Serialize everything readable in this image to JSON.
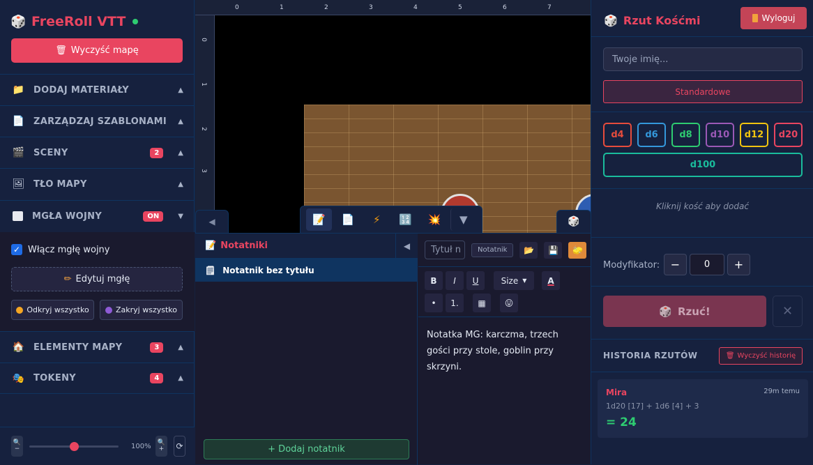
{
  "app": {
    "title": "FreeRoll VTT"
  },
  "left": {
    "clear_map": "Wyczyść mapę",
    "sections": [
      {
        "label": "DODAJ MATERIAŁY",
        "icon": "folder-icon"
      },
      {
        "label": "ZARZĄDZAJ SZABLONAMI",
        "icon": "document-icon"
      },
      {
        "label": "SCENY",
        "icon": "clapper-icon",
        "badge": "2"
      },
      {
        "label": "TŁO MAPY",
        "icon": "picture-icon"
      },
      {
        "label": "MGŁA WOJNY",
        "icon": "fog-icon",
        "badge": "ON"
      },
      {
        "label": "ELEMENTY MAPY",
        "icon": "house-icon",
        "badge": "3"
      },
      {
        "label": "TOKENY",
        "icon": "masks-icon",
        "badge": "4"
      }
    ],
    "fog": {
      "enable_label": "Włącz mgłę wojny",
      "edit_label": "Edytuj mgłę",
      "reveal_all": "Odkryj wszystko",
      "hide_all": "Zakryj wszystko"
    },
    "zoom": {
      "value": "100%",
      "level": 0.5
    }
  },
  "canvas": {
    "ruler_x": [
      "0",
      "1",
      "2",
      "3",
      "4",
      "5",
      "6",
      "7"
    ],
    "ruler_y": [
      "0",
      "1",
      "2",
      "3"
    ]
  },
  "notes": {
    "title": "Notatniki",
    "items": [
      "Notatnik bez tytułu"
    ],
    "add_label": "+ Dodaj notatnik",
    "title_placeholder": "Tytuł n",
    "type_tag": "Notatnik",
    "format": {
      "bold": "B",
      "italic": "I",
      "underline": "U",
      "size": "Size",
      "color": "A",
      "bullet": "•",
      "numbered": "1."
    },
    "content": "Notatka MG: karczma, trzech gości przy stole, goblin przy skrzyni."
  },
  "right": {
    "title": "Rzut Kośćmi",
    "logout": "Wyloguj",
    "name_placeholder": "Twoje imię...",
    "mode": "Standardowe",
    "dice": [
      {
        "label": "d4",
        "color": "#e74c3c"
      },
      {
        "label": "d6",
        "color": "#3498db"
      },
      {
        "label": "d8",
        "color": "#2ecc71"
      },
      {
        "label": "d10",
        "color": "#9b59b6"
      },
      {
        "label": "d12",
        "color": "#f1c40f"
      },
      {
        "label": "d20",
        "color": "#e94560"
      }
    ],
    "d100": "d100",
    "hint": "Kliknij kość aby dodać",
    "modifier_label": "Modyfikator:",
    "modifier_minus": "−",
    "modifier_value": "0",
    "modifier_plus": "+",
    "roll_label": "Rzuć!",
    "history_title": "HISTORIA RZUTÓW",
    "history_clear": "Wyczyść historię",
    "history": [
      {
        "name": "Mira",
        "time": "29m temu",
        "formula": "1d20 [17] + 1d6 [4] + 3",
        "total": "= 24"
      }
    ]
  }
}
